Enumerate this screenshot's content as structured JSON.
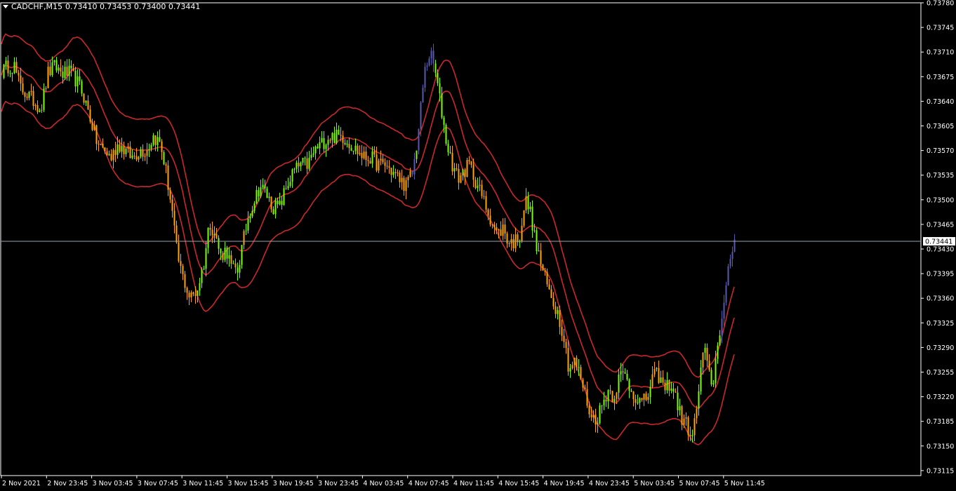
{
  "header": {
    "symbol_tf": "CADCHF,M15",
    "ohlc": "0.73410 0.73453 0.73400 0.73441"
  },
  "colors": {
    "background": "#000000",
    "frame": "#ffffff",
    "bull": "#7CFC00",
    "bear": "#FFA500",
    "neutral": "#5858B0",
    "bands": "#C8282A",
    "price_line": "#9AA3AC"
  },
  "chart_data": {
    "type": "candlestick",
    "symbol": "CADCHF",
    "timeframe": "M15",
    "ylim": [
      0.73115,
      0.7378
    ],
    "grid": false,
    "y_ticks": [
      "0.73780",
      "0.73745",
      "0.73710",
      "0.73675",
      "0.73640",
      "0.73605",
      "0.73570",
      "0.73535",
      "0.73500",
      "0.73465",
      "0.73430",
      "0.73395",
      "0.73360",
      "0.73325",
      "0.73290",
      "0.73255",
      "0.73220",
      "0.73185",
      "0.73150",
      "0.73115"
    ],
    "x_ticks": [
      "2 Nov 2021",
      "2 Nov 23:45",
      "3 Nov 03:45",
      "3 Nov 07:45",
      "3 Nov 11:45",
      "3 Nov 15:45",
      "3 Nov 19:45",
      "3 Nov 23:45",
      "4 Nov 03:45",
      "4 Nov 07:45",
      "4 Nov 11:45",
      "4 Nov 15:45",
      "4 Nov 19:45",
      "4 Nov 23:45",
      "5 Nov 03:45",
      "5 Nov 07:45",
      "5 Nov 11:45"
    ],
    "current_price": 0.73441,
    "current_price_label": "0.73441",
    "close_path": [
      [
        0,
        0.7368
      ],
      [
        10,
        0.7369
      ],
      [
        20,
        0.7369
      ],
      [
        28,
        0.7366
      ],
      [
        38,
        0.7365
      ],
      [
        48,
        0.7364
      ],
      [
        58,
        0.7363
      ],
      [
        68,
        0.7368
      ],
      [
        78,
        0.7369
      ],
      [
        88,
        0.7368
      ],
      [
        98,
        0.7368
      ],
      [
        108,
        0.7367
      ],
      [
        118,
        0.7365
      ],
      [
        124,
        0.7363
      ],
      [
        130,
        0.7361
      ],
      [
        138,
        0.7358
      ],
      [
        148,
        0.7357
      ],
      [
        158,
        0.7356
      ],
      [
        168,
        0.7358
      ],
      [
        178,
        0.7357
      ],
      [
        188,
        0.7356
      ],
      [
        198,
        0.7357
      ],
      [
        208,
        0.7357
      ],
      [
        218,
        0.7359
      ],
      [
        228,
        0.7358
      ],
      [
        236,
        0.7354
      ],
      [
        244,
        0.7349
      ],
      [
        252,
        0.7342
      ],
      [
        260,
        0.7339
      ],
      [
        270,
        0.7336
      ],
      [
        280,
        0.7337
      ],
      [
        290,
        0.7341
      ],
      [
        298,
        0.7347
      ],
      [
        306,
        0.7345
      ],
      [
        314,
        0.7342
      ],
      [
        322,
        0.7343
      ],
      [
        330,
        0.734
      ],
      [
        338,
        0.734
      ],
      [
        346,
        0.7344
      ],
      [
        354,
        0.7348
      ],
      [
        362,
        0.735
      ],
      [
        370,
        0.7352
      ],
      [
        378,
        0.7351
      ],
      [
        388,
        0.7349
      ],
      [
        398,
        0.7349
      ],
      [
        408,
        0.7352
      ],
      [
        418,
        0.7354
      ],
      [
        428,
        0.7355
      ],
      [
        438,
        0.7355
      ],
      [
        448,
        0.7357
      ],
      [
        458,
        0.7358
      ],
      [
        468,
        0.7359
      ],
      [
        478,
        0.7359
      ],
      [
        488,
        0.7359
      ],
      [
        498,
        0.7358
      ],
      [
        508,
        0.7357
      ],
      [
        518,
        0.7356
      ],
      [
        528,
        0.7356
      ],
      [
        538,
        0.7355
      ],
      [
        548,
        0.7355
      ],
      [
        558,
        0.7354
      ],
      [
        568,
        0.7353
      ],
      [
        578,
        0.7352
      ],
      [
        588,
        0.7354
      ],
      [
        596,
        0.736
      ],
      [
        604,
        0.7368
      ],
      [
        612,
        0.7371
      ],
      [
        620,
        0.7368
      ],
      [
        628,
        0.7363
      ],
      [
        636,
        0.7358
      ],
      [
        644,
        0.7355
      ],
      [
        652,
        0.7353
      ],
      [
        660,
        0.7354
      ],
      [
        668,
        0.7355
      ],
      [
        676,
        0.7353
      ],
      [
        684,
        0.7351
      ],
      [
        692,
        0.7349
      ],
      [
        700,
        0.7347
      ],
      [
        708,
        0.7345
      ],
      [
        716,
        0.7346
      ],
      [
        724,
        0.7344
      ],
      [
        732,
        0.7344
      ],
      [
        740,
        0.7345
      ],
      [
        748,
        0.735
      ],
      [
        756,
        0.7348
      ],
      [
        762,
        0.7344
      ],
      [
        770,
        0.7341
      ],
      [
        778,
        0.7338
      ],
      [
        786,
        0.7336
      ],
      [
        794,
        0.7334
      ],
      [
        802,
        0.7331
      ],
      [
        810,
        0.7326
      ],
      [
        818,
        0.7327
      ],
      [
        826,
        0.7325
      ],
      [
        834,
        0.7322
      ],
      [
        842,
        0.7319
      ],
      [
        850,
        0.7319
      ],
      [
        858,
        0.7321
      ],
      [
        866,
        0.7323
      ],
      [
        874,
        0.7322
      ],
      [
        882,
        0.7325
      ],
      [
        890,
        0.7325
      ],
      [
        898,
        0.7323
      ],
      [
        906,
        0.7322
      ],
      [
        914,
        0.7321
      ],
      [
        922,
        0.7322
      ],
      [
        930,
        0.7325
      ],
      [
        938,
        0.7325
      ],
      [
        946,
        0.7323
      ],
      [
        954,
        0.7324
      ],
      [
        962,
        0.7322
      ],
      [
        970,
        0.7319
      ],
      [
        978,
        0.7318
      ],
      [
        986,
        0.7316
      ],
      [
        994,
        0.7322
      ],
      [
        1002,
        0.7329
      ],
      [
        1010,
        0.7325
      ],
      [
        1016,
        0.7324
      ],
      [
        1022,
        0.733
      ],
      [
        1028,
        0.7333
      ],
      [
        1034,
        0.7337
      ],
      [
        1040,
        0.7342
      ],
      [
        1046,
        0.7344
      ]
    ],
    "bands_offset": 0.00048
  }
}
